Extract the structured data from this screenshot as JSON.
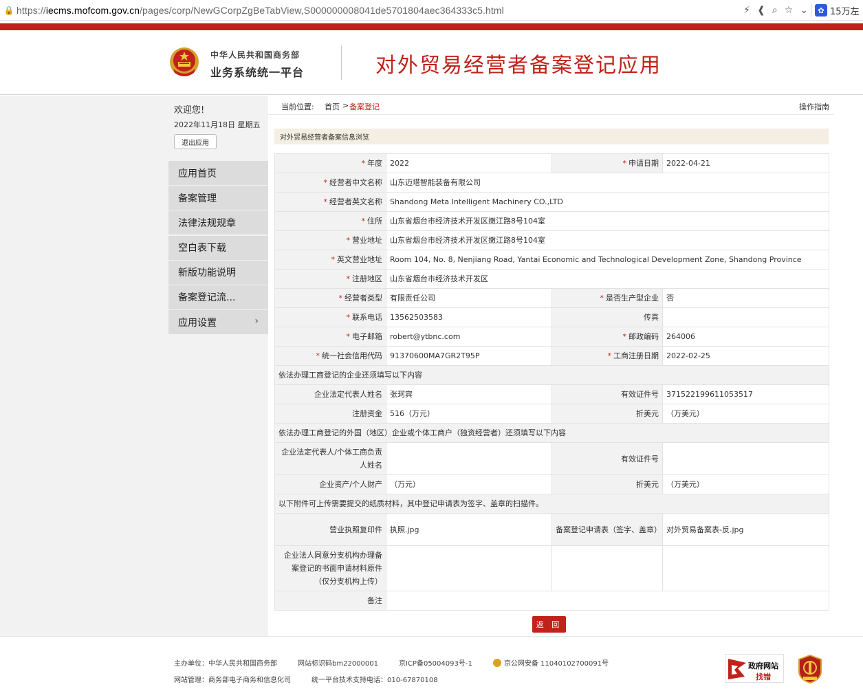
{
  "browser": {
    "url_scheme": "https://",
    "url_host": "iecms.mofcom.gov.cn",
    "url_path": "/pages/corp/NewGCorpZgBeTabView,S000000008041de5701804aec364333c5.html",
    "extension_label": "15万左"
  },
  "header": {
    "org_line1": "中华人民共和国商务部",
    "org_line2": "业务系统统一平台",
    "app_title": "对外贸易经营者备案登记应用"
  },
  "sidebar": {
    "welcome": "欢迎您!",
    "date": "2022年11月18日 星期五",
    "logout": "退出应用",
    "items": [
      {
        "label": "应用首页"
      },
      {
        "label": "备案管理"
      },
      {
        "label": "法律法规规章"
      },
      {
        "label": "空白表下载"
      },
      {
        "label": "新版功能说明"
      },
      {
        "label": "备案登记流..."
      },
      {
        "label": "应用设置"
      }
    ]
  },
  "breadcrumb": {
    "label": "当前位置:",
    "home": "首页",
    "sep": ">",
    "current": "备案登记",
    "guide": "操作指南"
  },
  "section_title": "对外贸易经营者备案信息浏览",
  "form": {
    "year_label": "年度",
    "year": "2022",
    "apply_date_label": "申请日期",
    "apply_date": "2022-04-21",
    "cn_name_label": "经营者中文名称",
    "cn_name": "山东迈塔智能装备有限公司",
    "en_name_label": "经营者英文名称",
    "en_name": "Shandong Meta Intelligent Machinery CO.,LTD",
    "address_label": "住所",
    "address": "山东省烟台市经济技术开发区嫩江路8号104室",
    "biz_address_label": "营业地址",
    "biz_address": "山东省烟台市经济技术开发区嫩江路8号104室",
    "en_biz_address_label": "英文营业地址",
    "en_biz_address": "Room 104, No. 8, Nenjiang Road, Yantai Economic and Technological Development Zone, Shandong Province",
    "reg_area_label": "注册地区",
    "reg_area": "山东省烟台市经济技术开发区",
    "type_label": "经营者类型",
    "type": "有限责任公司",
    "is_producer_label": "是否生产型企业",
    "is_producer": "否",
    "phone_label": "联系电话",
    "phone": "13562503583",
    "fax_label": "传真",
    "fax": "",
    "email_label": "电子邮箱",
    "email": "robert@ytbnc.com",
    "zip_label": "邮政编码",
    "zip": "264006",
    "credit_code_label": "统一社会信用代码",
    "credit_code": "91370600MA7GR2T95P",
    "ic_date_label": "工商注册日期",
    "ic_date": "2022-02-25",
    "domestic_note": "依法办理工商登记的企业还须填写以下内容",
    "legal_rep_label": "企业法定代表人姓名",
    "legal_rep": "张珂宾",
    "id_no_label": "有效证件号",
    "id_no": "371522199611053517",
    "capital_label": "注册资金",
    "capital": "516（万元）",
    "usd_label": "折美元",
    "usd": "（万美元）",
    "foreign_note": "依法办理工商登记的外国（地区）企业或个体工商户（独资经营者）还须填写以下内容",
    "foreign_rep_label": "企业法定代表人/个体工商负责人姓名",
    "foreign_rep": "",
    "foreign_id_label": "有效证件号",
    "foreign_id": "",
    "assets_label": "企业资产/个人财产",
    "assets": "（万元）",
    "assets_usd_label": "折美元",
    "assets_usd": "（万美元）",
    "attach_note": "以下附件可上传需要提交的纸质材料，其中登记申请表为签字、盖章的扫描件。",
    "license_label": "营业执照复印件",
    "license": "执照.jpg",
    "form_label": "备案登记申请表（签字、盖章）",
    "form_file": "对外贸易备案表-反.jpg",
    "branch_label": "企业法人同意分支机构办理备案登记的书面申请材料原件（仅分支机构上传）",
    "branch": "",
    "remark_label": "备注",
    "remark": ""
  },
  "back_button": "返 回",
  "footer": {
    "host": "主办单位：中华人民共和国商务部",
    "site_id": "网站标识码bm22000001",
    "icp": "京ICP备05004093号-1",
    "police": "京公网安备 11040102700091号",
    "manage": "网站管理：商务部电子商务和信息化司",
    "support": "统一平台技术支持电话：010-67870108",
    "gov_badge_line1": "政府网站",
    "gov_badge_line2": "找错"
  },
  "colors": {
    "brand_red": "#c1221a",
    "menu_bg": "#dcdcdc",
    "label_bg": "#f2f2f2"
  }
}
